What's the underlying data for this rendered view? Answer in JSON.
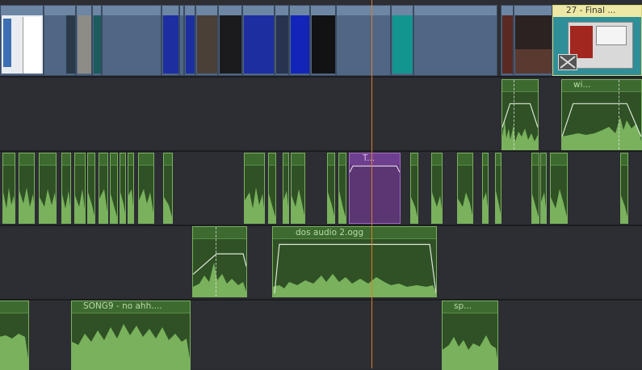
{
  "timeline": {
    "video_track": {
      "clips": [
        {
          "label": "27 - Final ...",
          "selected_color": "#ede8a6"
        }
      ]
    },
    "audio_track_1": {
      "clips": [
        {
          "label": ""
        },
        {
          "label": "wi..."
        }
      ]
    },
    "audio_track_2": {
      "clips": [
        {
          "label": "T...",
          "color": "#5a3672"
        }
      ]
    },
    "audio_track_3": {
      "clips": [
        {
          "label": ""
        },
        {
          "label": "dos audio 2.ogg"
        }
      ]
    },
    "audio_track_4": {
      "clips": [
        {
          "label": ""
        },
        {
          "label": "SONG9 - no ahh...."
        },
        {
          "label": "sp..."
        }
      ]
    }
  },
  "colors": {
    "background": "#2b2c31",
    "audio_clip": "#2f5125",
    "audio_wave": "#79b15c",
    "video_clip": "#4f6784",
    "playhead": "#e07a2a"
  },
  "icons": {
    "missing_thumbnail": "broken-image-icon"
  }
}
